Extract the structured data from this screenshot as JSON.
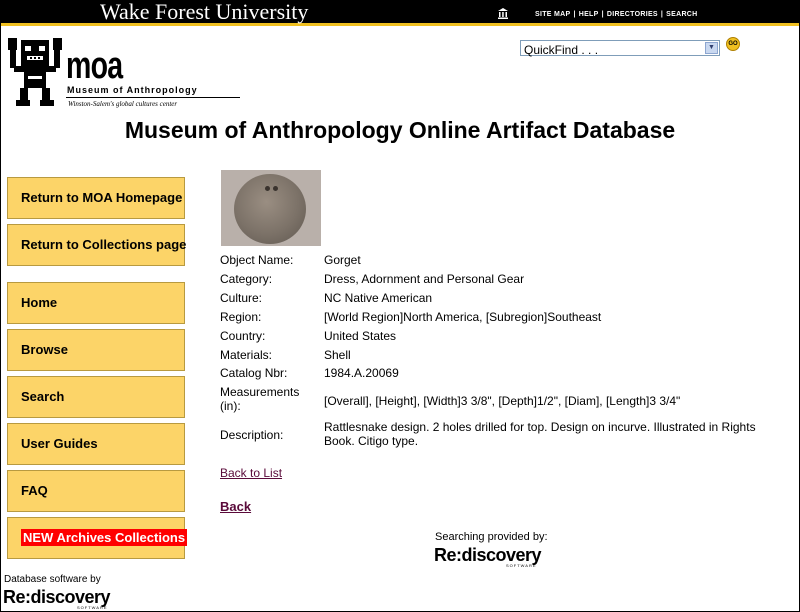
{
  "header": {
    "university": "Wake Forest University",
    "links": [
      "SITE MAP",
      "HELP",
      "DIRECTORIES",
      "SEARCH"
    ],
    "quickfind_value": "QuickFind . . .",
    "go_label": "GO"
  },
  "logo": {
    "name": "moa",
    "subtitle": "Museum of Anthropology",
    "tagline": "Winston-Salem's global cultures center"
  },
  "page_title": "Museum of Anthropology Online Artifact Database",
  "nav": {
    "return_home": "Return to MOA Homepage",
    "return_collections": "Return to Collections page",
    "home": "Home",
    "browse": "Browse",
    "search": "Search",
    "user_guides": "User Guides",
    "faq": "FAQ",
    "new_archives": "NEW Archives Collections"
  },
  "artifact": {
    "fields": [
      {
        "label": "Object Name:",
        "value": "Gorget"
      },
      {
        "label": "Category:",
        "value": "Dress, Adornment and Personal Gear"
      },
      {
        "label": "Culture:",
        "value": "NC Native American"
      },
      {
        "label": "Region:",
        "value": "[World Region]North America, [Subregion]Southeast"
      },
      {
        "label": "Country:",
        "value": "United States"
      },
      {
        "label": "Materials:",
        "value": "Shell"
      },
      {
        "label": "Catalog Nbr:",
        "value": "1984.A.20069"
      },
      {
        "label": "Measurements (in):",
        "value": "[Overall], [Height], [Width]3 3/8\", [Depth]1/2\", [Diam], [Length]3 3/4\""
      },
      {
        "label": "Description:",
        "value": "Rattlesnake design. 2 holes drilled for top. Design on incurve. Illustrated in Rights Book. Citigo type."
      }
    ]
  },
  "links": {
    "back_to_list": "Back to List",
    "back": "Back"
  },
  "footer": {
    "searching_provided": "Searching provided by:",
    "rediscovery": "Re:discovery",
    "rediscovery_sub": "SOFTWARE",
    "database_software": "Database software by"
  },
  "colors": {
    "nav_button": "#fcd468",
    "top_bar": "#000000",
    "gold_stripe": "#f0c020",
    "link": "#5a0a3a",
    "highlight": "#ff0000"
  }
}
